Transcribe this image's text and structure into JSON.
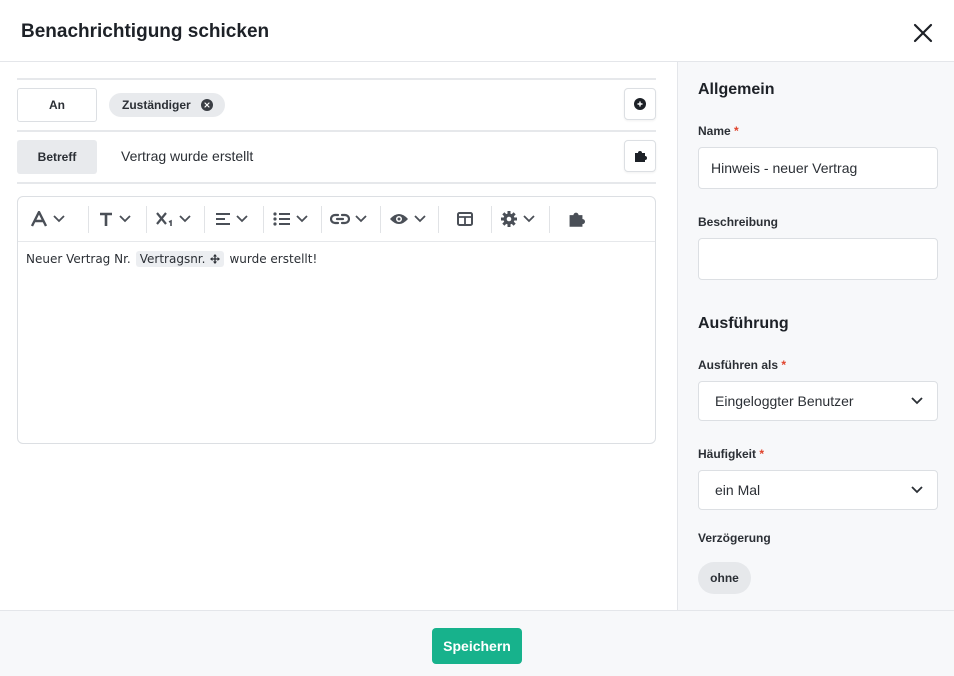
{
  "dialog": {
    "title": "Benachrichtigung schicken"
  },
  "recipients": {
    "label": "An",
    "chips": [
      {
        "label": "Zuständiger"
      }
    ]
  },
  "subject": {
    "label": "Betreff",
    "value": "Vertrag wurde erstellt"
  },
  "editor": {
    "text_before": "Neuer Vertrag Nr.",
    "placeholder_token": "Vertragsnr.",
    "text_after": "wurde erstellt!"
  },
  "general": {
    "heading": "Allgemein",
    "name_label": "Name",
    "name_value": "Hinweis - neuer Vertrag",
    "description_label": "Beschreibung",
    "description_value": ""
  },
  "execution": {
    "heading": "Ausführung",
    "run_as_label": "Ausführen als",
    "run_as_value": "Eingeloggter Benutzer",
    "frequency_label": "Häufigkeit",
    "frequency_value": "ein Mal",
    "delay_label": "Verzögerung",
    "delay_value": "ohne"
  },
  "required_marker": "*",
  "footer": {
    "save_label": "Speichern"
  },
  "colors": {
    "accent": "#17b28c",
    "required": "#e0432c"
  }
}
